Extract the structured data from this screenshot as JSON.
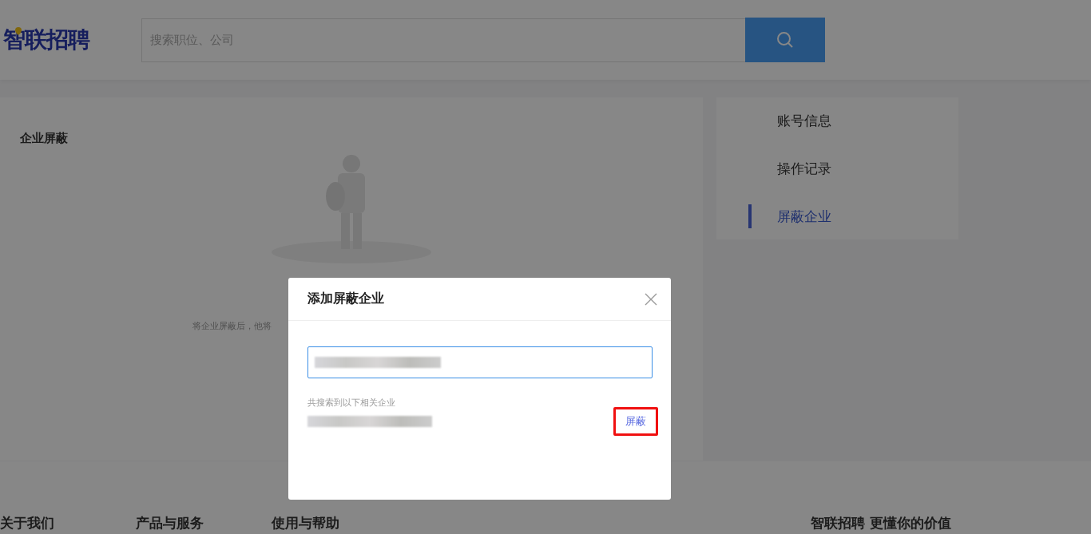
{
  "header": {
    "logo": "智联招聘",
    "search": {
      "placeholder": "搜索职位、公司"
    }
  },
  "main": {
    "title": "企业屏蔽",
    "empty_hint": "将企业屏蔽后，他将"
  },
  "sidebar": {
    "items": [
      {
        "label": "账号信息",
        "selected": false
      },
      {
        "label": "操作记录",
        "selected": false
      },
      {
        "label": "屏蔽企业",
        "selected": true
      }
    ]
  },
  "footer": {
    "columns": [
      "关于我们",
      "产品与服务",
      "使用与帮助"
    ],
    "slogan": "智联招聘 更懂你的价值"
  },
  "dialog": {
    "title": "添加屏蔽企业",
    "results_label": "共搜索到以下相关企业",
    "results": [
      {
        "action": "屏蔽",
        "highlighted": true
      }
    ]
  }
}
